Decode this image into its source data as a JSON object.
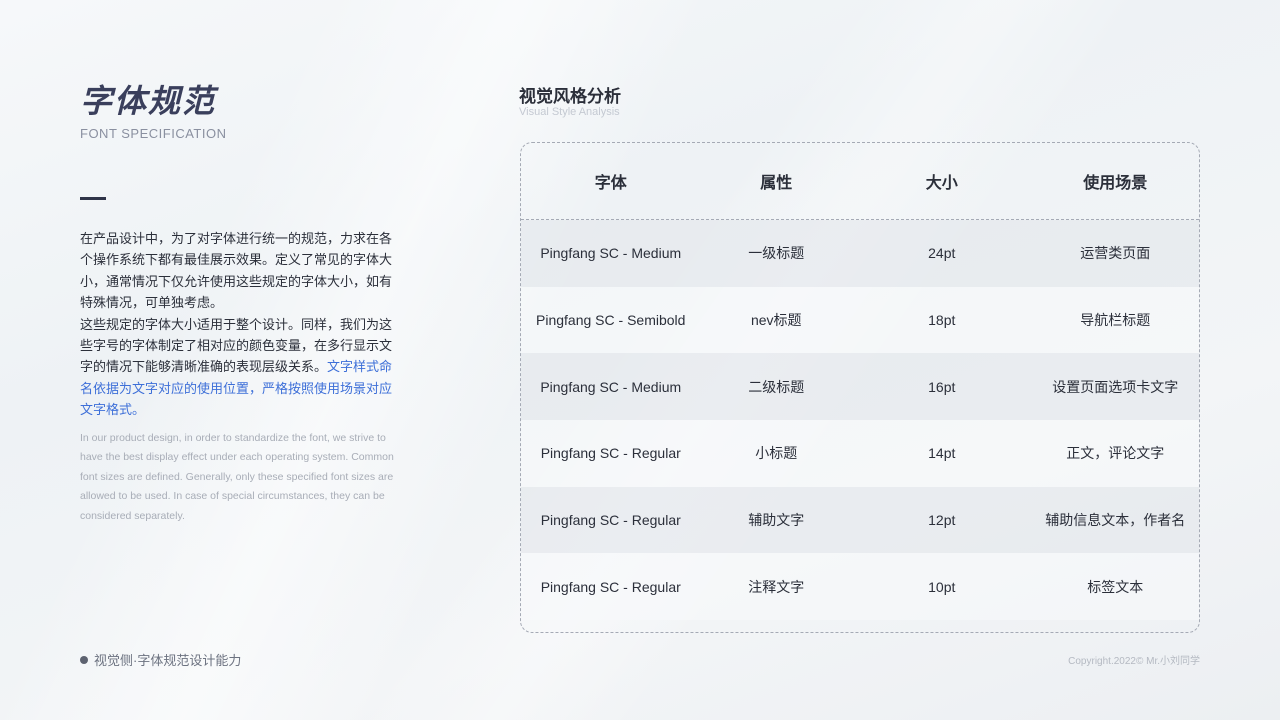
{
  "left": {
    "title": "字体规范",
    "subtitle": "FONT SPECIFICATION",
    "desc_part1": "在产品设计中，为了对字体进行统一的规范，力求在各个操作系统下都有最佳展示效果。定义了常见的字体大小，通常情况下仅允许使用这些规定的字体大小，如有特殊情况，可单独考虑。",
    "desc_part2": "这些规定的字体大小适用于整个设计。同样，我们为这些字号的字体制定了相对应的颜色变量，在多行显示文字的情况下能够清晰准确的表现层级关系。",
    "desc_highlight": "文字样式命名依据为文字对应的使用位置，严格按照使用场景对应文字格式。",
    "desc_en": "In our product design, in order to standardize the font, we strive to have the best display effect under each operating system. Common font sizes are defined. Generally, only these specified font sizes are allowed to be used. In case of special circumstances, they can be considered separately."
  },
  "section": {
    "title": "视觉风格分析",
    "subtitle": "Visual Style Analysis"
  },
  "table": {
    "headers": [
      "字体",
      "属性",
      "大小",
      "使用场景"
    ],
    "rows": [
      [
        "Pingfang SC - Medium",
        "一级标题",
        "24pt",
        "运营类页面"
      ],
      [
        "Pingfang SC - Semibold",
        "nev标题",
        "18pt",
        "导航栏标题"
      ],
      [
        "Pingfang SC - Medium",
        "二级标题",
        "16pt",
        "设置页面选项卡文字"
      ],
      [
        "Pingfang SC - Regular",
        "小标题",
        "14pt",
        "正文，评论文字"
      ],
      [
        "Pingfang SC - Regular",
        "辅助文字",
        "12pt",
        "辅助信息文本，作者名"
      ],
      [
        "Pingfang SC - Regular",
        "注释文字",
        "10pt",
        "标签文本"
      ]
    ]
  },
  "footer": {
    "left": "视觉侧·字体规范设计能力",
    "right": "Copyright.2022© Mr.小刘同学"
  },
  "colors": {
    "highlight": "#3d6fd8",
    "title": "#3a3f5c"
  }
}
